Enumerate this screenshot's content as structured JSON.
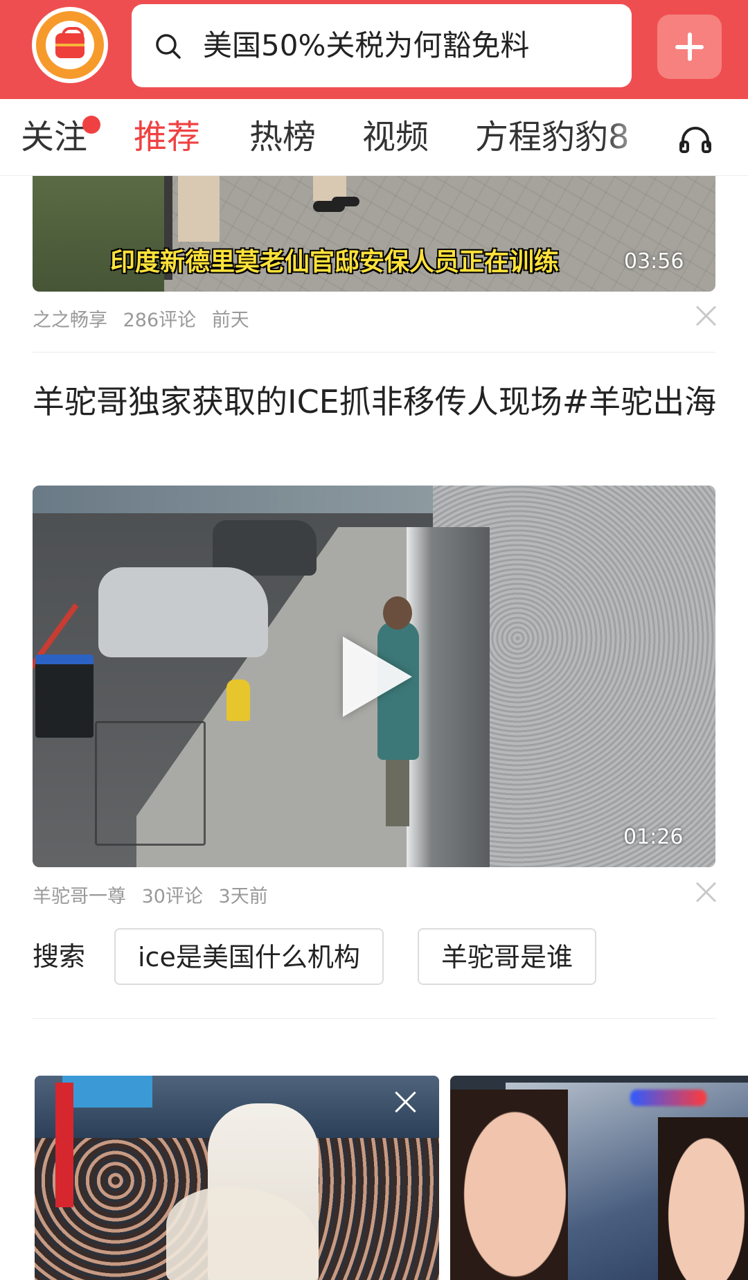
{
  "header": {
    "search_text": "美国50%关税为何豁免料",
    "logo_icon": "shopping-bag-logo-icon",
    "search_icon": "search-icon",
    "camera_icon": "camera-icon",
    "add_icon": "plus-icon",
    "brand_color": "#ef4e50"
  },
  "tabs": {
    "items": [
      {
        "label": "关注",
        "active": false,
        "has_dot": true
      },
      {
        "label": "推荐",
        "active": true
      },
      {
        "label": "热榜",
        "active": false
      },
      {
        "label": "视频",
        "active": false
      },
      {
        "label": "方程豹豹8",
        "active": false
      }
    ],
    "audio_icon": "headphones-icon",
    "active_color": "#f04142"
  },
  "feed": [
    {
      "caption": "印度新德里莫老仙官邸安保人员正在训练",
      "duration": "03:56",
      "author": "之之畅享",
      "comments": "286评论",
      "time": "前天"
    },
    {
      "title": "羊驼哥独家获取的ICE抓非移传人现场#羊驼出海",
      "duration": "01:26",
      "author": "羊驼哥一尊",
      "comments": "30评论",
      "time": "3天前",
      "related_search": {
        "label": "搜索",
        "chips": [
          "ice是美国什么机构",
          "羊驼哥是谁"
        ]
      }
    }
  ]
}
